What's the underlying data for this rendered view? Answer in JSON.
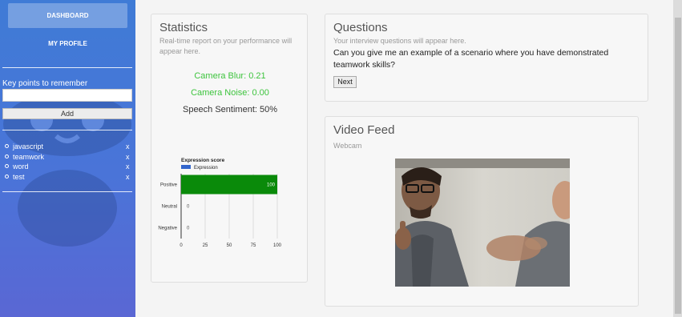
{
  "sidebar": {
    "nav": [
      {
        "label": "DASHBOARD",
        "active": true
      },
      {
        "label": "MY PROFILE",
        "active": false
      }
    ],
    "key_points_label": "Key points to remember",
    "input_value": "",
    "add_label": "Add",
    "items": [
      {
        "label": "javascript",
        "remove": "x"
      },
      {
        "label": "teamwork",
        "remove": "x"
      },
      {
        "label": "word",
        "remove": "x"
      },
      {
        "label": "test",
        "remove": "x"
      }
    ]
  },
  "statistics": {
    "title": "Statistics",
    "subtitle": "Real-time report on your performance will appear here.",
    "camera_blur": "Camera Blur: 0.21",
    "camera_noise": "Camera Noise: 0.00",
    "speech_sentiment": "Speech Sentiment: 50%"
  },
  "questions": {
    "title": "Questions",
    "subtitle": "Your interview questions will appear here.",
    "question": "Can you give me an example of a scenario where you have demonstrated teamwork skills?",
    "next_label": "Next"
  },
  "video": {
    "title": "Video Feed",
    "subtitle": "Webcam"
  },
  "colors": {
    "bar": "#0a8a0a",
    "legend": "#3366cc",
    "stat_green": "#3ec43e"
  },
  "chart_data": {
    "type": "bar",
    "orientation": "horizontal",
    "title": "Expression score",
    "series": [
      {
        "name": "Expression",
        "values": [
          100,
          0,
          0
        ]
      }
    ],
    "categories": [
      "Positive",
      "Neutral",
      "Negative"
    ],
    "data_labels": [
      "100",
      "0",
      "0"
    ],
    "xlim": [
      0,
      100
    ],
    "xticks": [
      0,
      25,
      50,
      75,
      100
    ],
    "grid": true,
    "legend_position": "top"
  }
}
